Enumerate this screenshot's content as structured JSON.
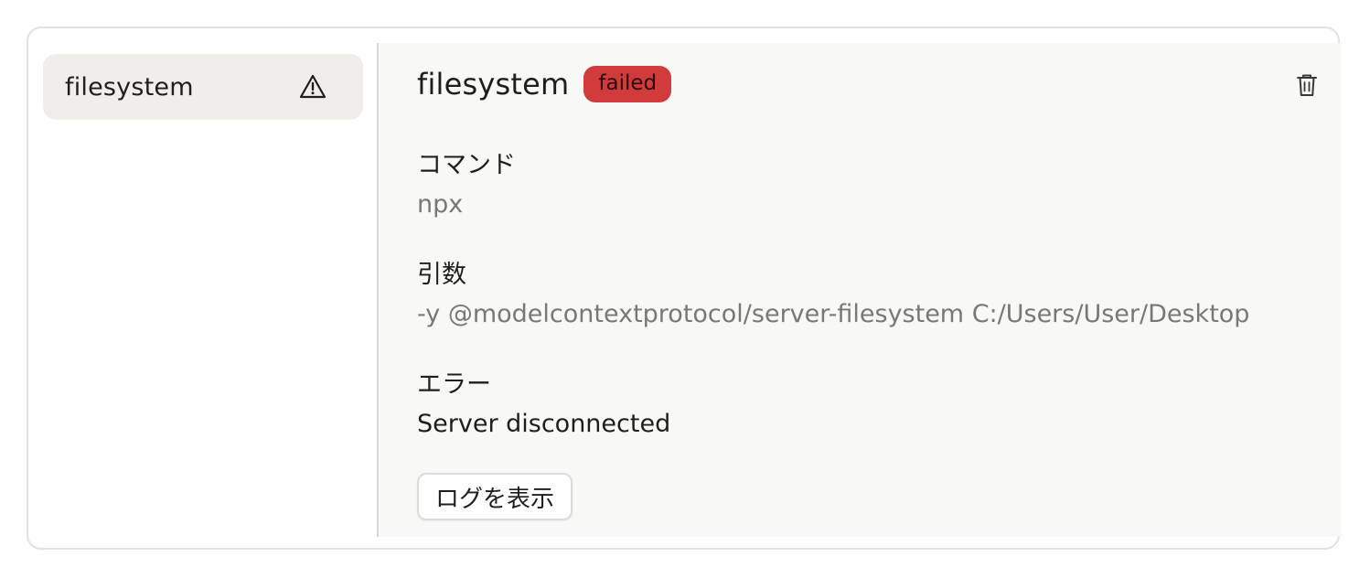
{
  "sidebar": {
    "items": [
      {
        "label": "filesystem",
        "icon": "warning-triangle-icon"
      }
    ]
  },
  "detail": {
    "title": "filesystem",
    "status_badge": "failed",
    "status_color": "#d13b3b",
    "command_label": "コマンド",
    "command_value": "npx",
    "args_label": "引数",
    "args_value": "-y @modelcontextprotocol/server-filesystem C:/Users/User/Desktop",
    "error_label": "エラー",
    "error_value": "Server disconnected",
    "show_logs_label": "ログを表示",
    "delete_icon": "trash-icon"
  }
}
